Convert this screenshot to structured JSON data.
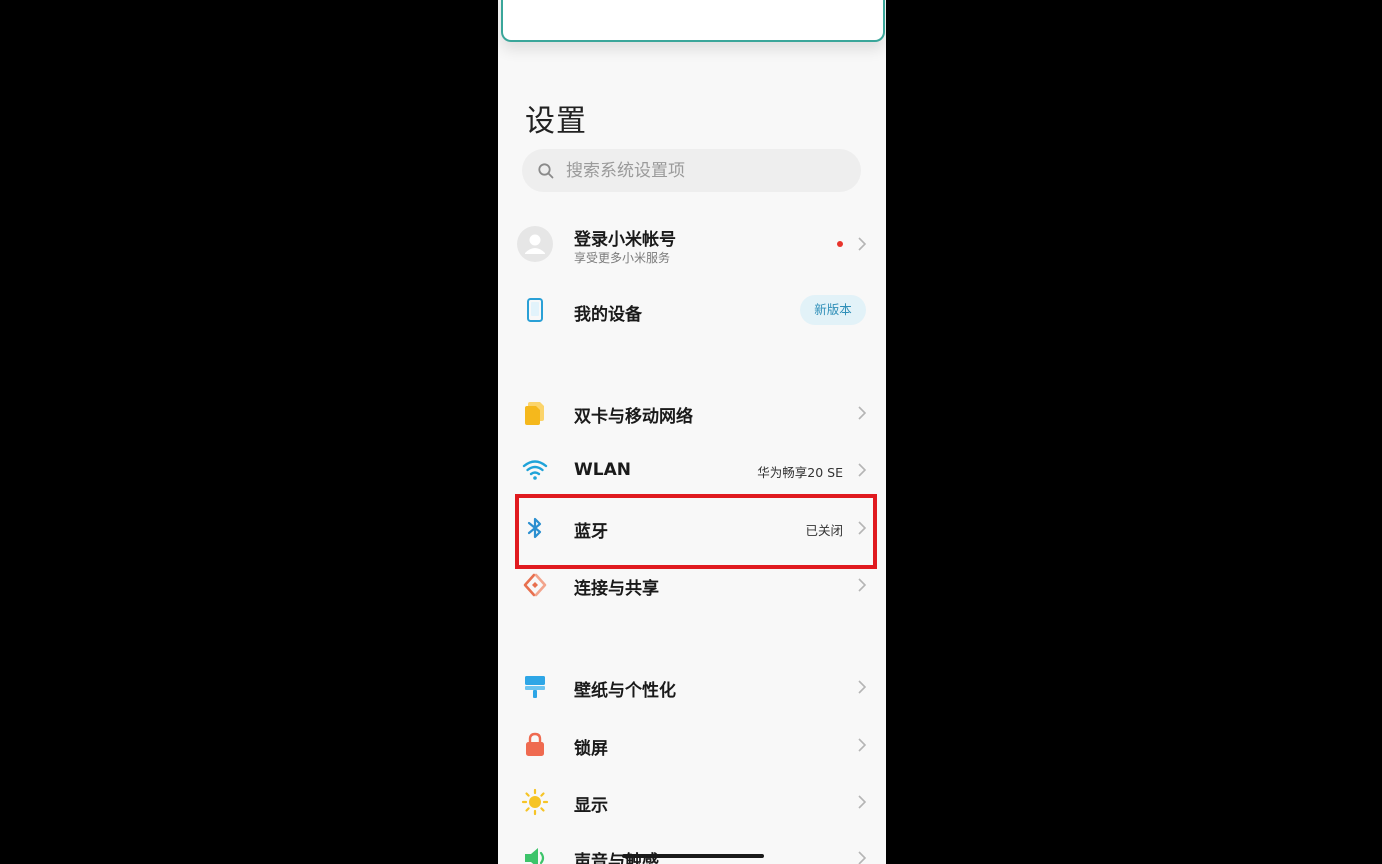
{
  "page_title": "设置",
  "search": {
    "placeholder": "搜索系统设置项"
  },
  "account": {
    "title": "登录小米帐号",
    "subtitle": "享受更多小米服务"
  },
  "device": {
    "title": "我的设备",
    "badge": "新版本"
  },
  "network_group": [
    {
      "label": "双卡与移动网络",
      "value": "",
      "icon": "sim-card-icon"
    },
    {
      "label": "WLAN",
      "value": "华为畅享20 SE",
      "icon": "wifi-icon"
    },
    {
      "label": "蓝牙",
      "value": "已关闭",
      "icon": "bluetooth-icon"
    },
    {
      "label": "连接与共享",
      "value": "",
      "icon": "connection-share-icon"
    }
  ],
  "display_group": [
    {
      "label": "壁纸与个性化",
      "icon": "wallpaper-icon"
    },
    {
      "label": "锁屏",
      "icon": "lock-icon"
    },
    {
      "label": "显示",
      "icon": "brightness-icon"
    },
    {
      "label": "声音与触感",
      "icon": "sound-icon"
    }
  ],
  "colors": {
    "highlight": "#e01a1f",
    "accent_blue": "#2f8fb8",
    "sim_yellow": "#f5b81c",
    "wifi_blue": "#1fa3d9",
    "share_orange": "#e8704f",
    "lock_coral": "#ef6a50",
    "brightness_yellow": "#f6c425",
    "sound_green": "#3dc46a"
  }
}
